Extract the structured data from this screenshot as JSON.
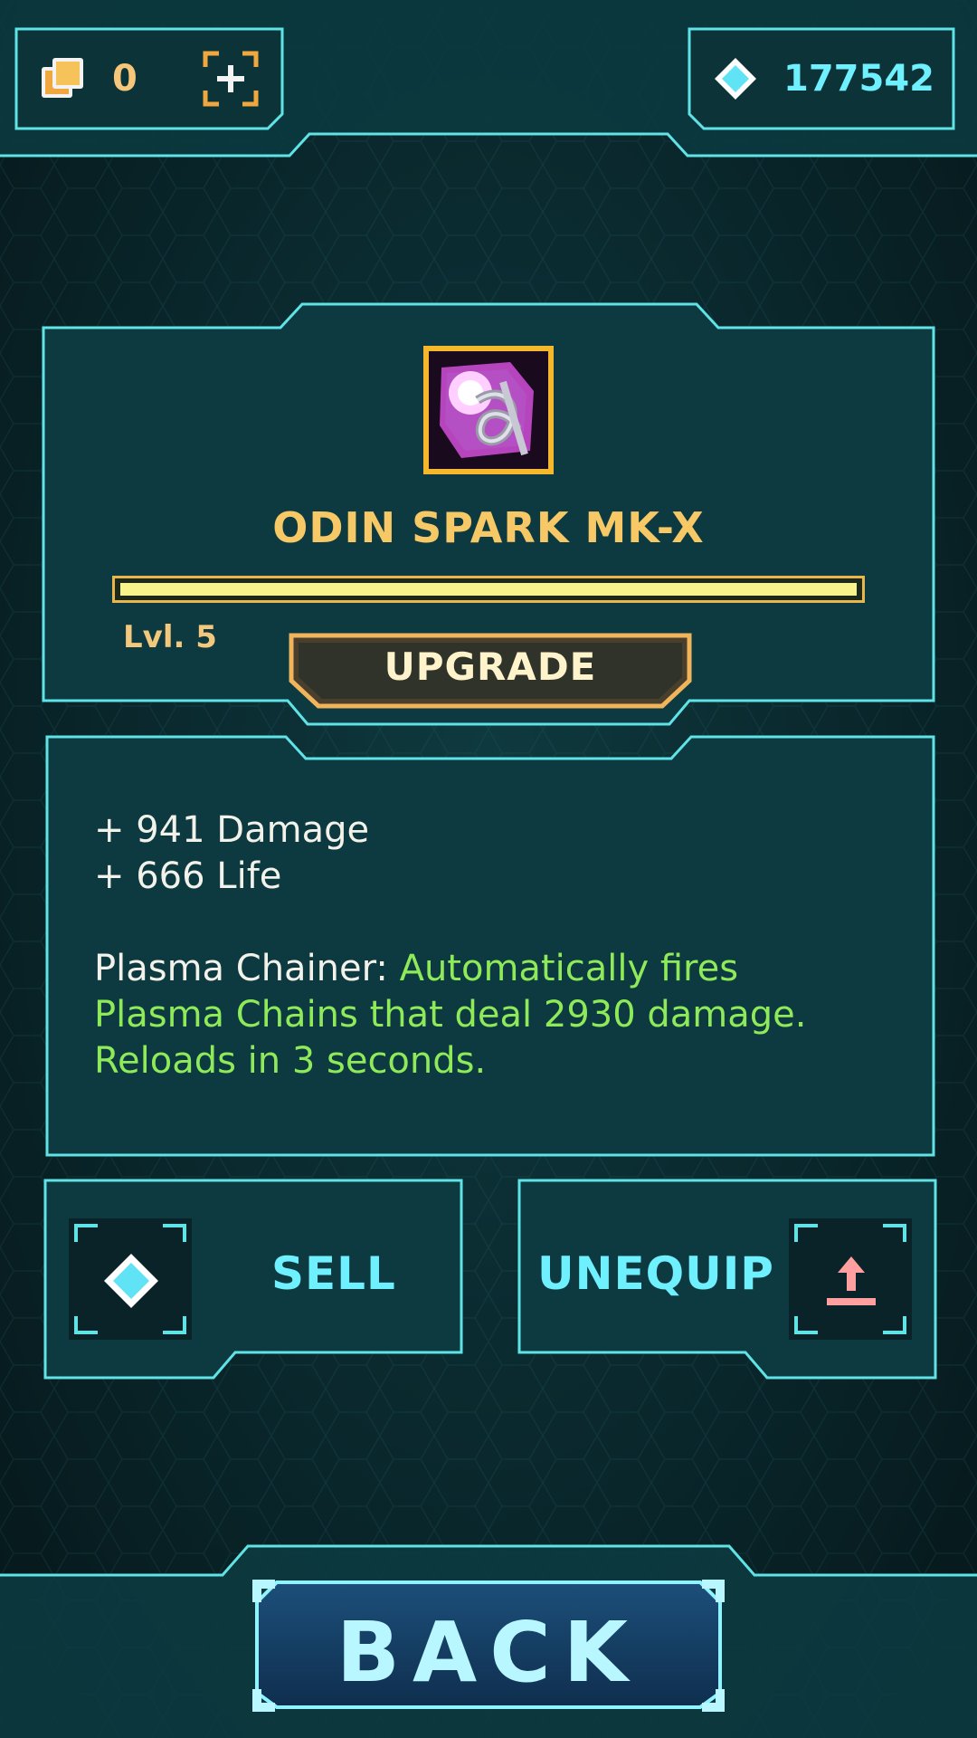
{
  "currency": {
    "cards_count": "0",
    "gems_count": "177542"
  },
  "item": {
    "name": "ODIN SPARK MK-X",
    "level_label": "Lvl. 5",
    "level_progress": 1.0,
    "upgrade_label": "UPGRADE"
  },
  "stats": {
    "damage_line": "+ 941 Damage",
    "life_line": "+ 666 Life",
    "ability_name": "Plasma Chainer: ",
    "ability_desc_1": "Automatically fires",
    "ability_desc_2": "Plasma Chains that deal 2930 damage.",
    "ability_desc_3": "Reloads in 3 seconds."
  },
  "actions": {
    "sell_label": "SELL",
    "unequip_label": "UNEQUIP",
    "back_label": "BACK"
  },
  "colors": {
    "frame": "#5fe3e6",
    "gold": "#f7c866",
    "cyan_text": "#6ff0ff",
    "green_text": "#8fea5a",
    "unequip_icon": "#ff9f9f"
  },
  "icons": [
    "cards-icon",
    "add-cards-icon",
    "gem-icon",
    "item-icon",
    "sell-gem-icon",
    "unequip-arrow-icon"
  ]
}
